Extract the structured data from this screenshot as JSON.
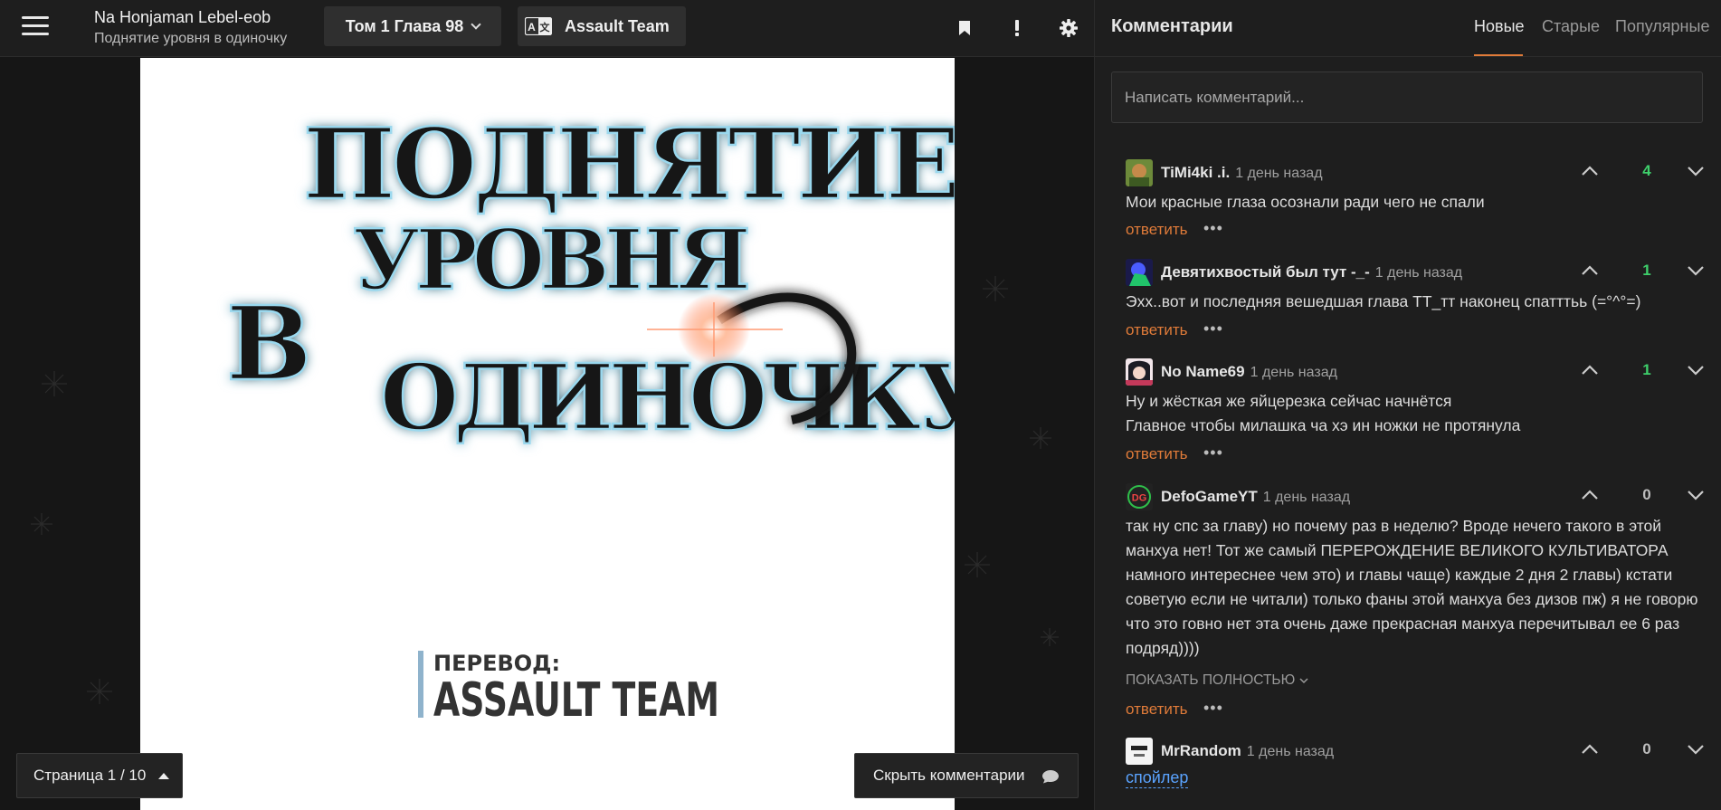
{
  "header": {
    "title": "Na Honjaman Lebel-eob",
    "subtitle": "Поднятие уровня в одиночку",
    "chapter": "Том 1 Глава 98",
    "team": "Assault Team"
  },
  "reader": {
    "page_indicator": "Страница 1 / 10",
    "hide_comments_label": "Скрыть комментарии",
    "page_title_art": "ПОДНЯТИЕ УРОВНЯ В ОДИНОЧКУ",
    "credit_label": "ПЕРЕВОД:",
    "credit_team": "ASSAULT TEAM"
  },
  "comments": {
    "title": "Комментарии",
    "tabs": [
      "Новые",
      "Старые",
      "Популярные"
    ],
    "active_tab": "Новые",
    "input_placeholder": "Написать комментарий...",
    "reply_label": "ответить",
    "more_label": "•••",
    "show_full_label": "ПОКАЗАТЬ ПОЛНОСТЬЮ",
    "colors": {
      "accent": "#e07b39",
      "positive": "#3ecf6b",
      "neutral": "#bdbdbd",
      "spoiler": "#5aa3ff"
    },
    "items": [
      {
        "author": "TiMi4ki .i.",
        "time": "1 день назад",
        "votes": "4",
        "text": "Мои красные глаза осознали ради чего не спали"
      },
      {
        "author": "Девятихвостый был тут -_-",
        "time": "1 день назад",
        "votes": "1",
        "text": "Эхх..вот и последняя вешедшая глава ТТ_тт наконец спатттьь (=°^°=)"
      },
      {
        "author": "No Name69",
        "time": "1 день назад",
        "votes": "1",
        "text_lines": [
          "Ну и жёсткая же яйцерезка сейчас начнётся",
          "Главное чтобы милашка ча хэ ин ножки не протянула"
        ]
      },
      {
        "author": "DefoGameYT",
        "time": "1 день назад",
        "votes": "0",
        "text": "так ну спс за главу) но почему раз в неделю? Вроде нечего такого в этой манхуа нет! Тот же самый ПЕРЕРОЖДЕНИЕ ВЕЛИКОГО КУЛЬТИВАТОРА намного интереснее чем это) и главы чаще) каждые 2 дня 2 главы) кстати советую если не читали) только фаны этой манхуа без дизов пж) я не говорю что это говно нет эта очень даже прекрасная манхуа перечитывал ее 6 раз подряд))))"
      },
      {
        "author": "MrRandom",
        "time": "1 день назад",
        "votes": "0",
        "spoiler": "спойлер"
      }
    ]
  }
}
